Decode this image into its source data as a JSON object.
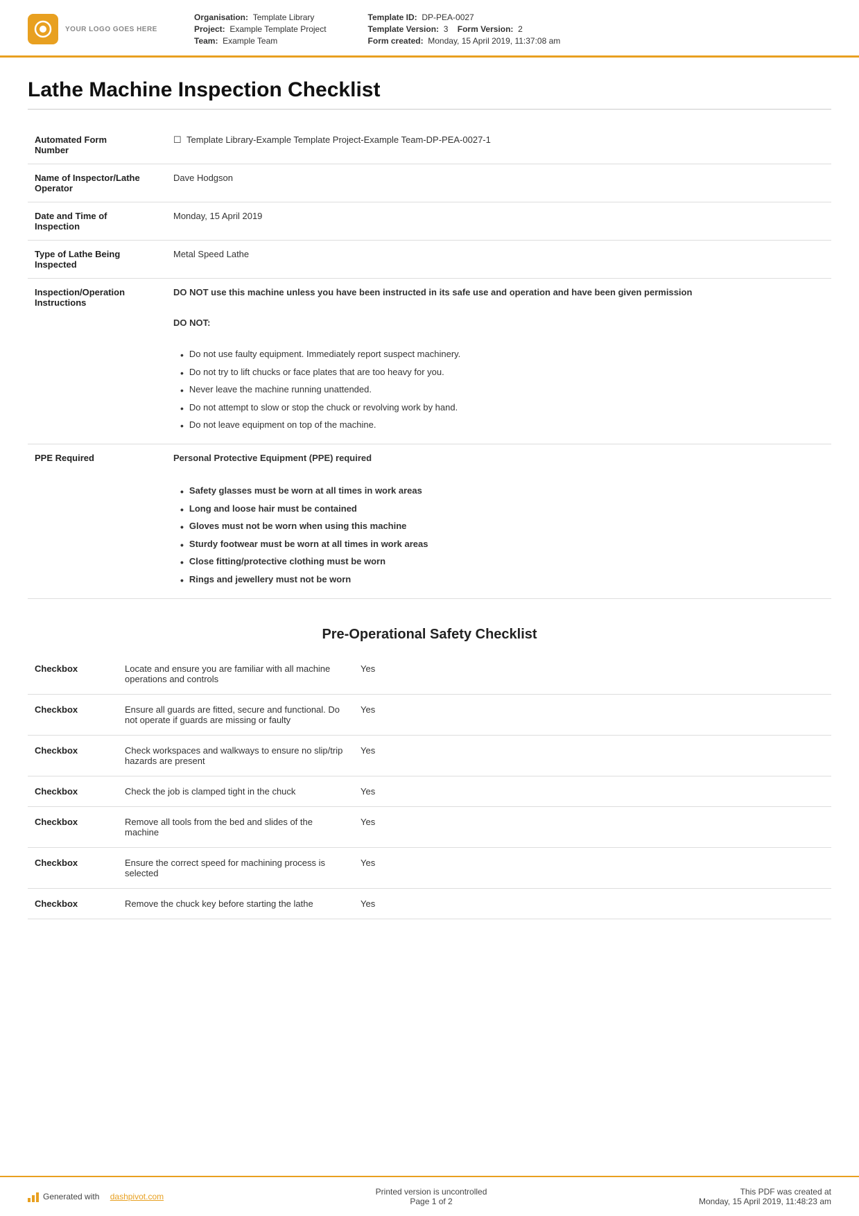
{
  "header": {
    "logo_text": "YOUR LOGO GOES HERE",
    "org_label": "Organisation:",
    "org_value": "Template Library",
    "project_label": "Project:",
    "project_value": "Example Template Project",
    "team_label": "Team:",
    "team_value": "Example Team",
    "template_id_label": "Template ID:",
    "template_id_value": "DP-PEA-0027",
    "template_version_label": "Template Version:",
    "template_version_value": "3",
    "form_version_label": "Form Version:",
    "form_version_value": "2",
    "form_created_label": "Form created:",
    "form_created_value": "Monday, 15 April 2019, 11:37:08 am"
  },
  "page_title": "Lathe Machine Inspection Checklist",
  "info_rows": [
    {
      "label": "Automated Form Number",
      "value": "Template Library-Example Template Project-Example Team-DP-PEA-0027-1",
      "has_icon": true
    },
    {
      "label": "Name of Inspector/Lathe Operator",
      "value": "Dave Hodgson"
    },
    {
      "label": "Date and Time of Inspection",
      "value": "Monday, 15 April 2019"
    },
    {
      "label": "Type of Lathe Being Inspected",
      "value": "Metal Speed Lathe"
    }
  ],
  "instructions": {
    "label": "Inspection/Operation Instructions",
    "bold_text": "DO NOT use this machine unless you have been instructed in its safe use and operation and have been given permission",
    "do_not_header": "DO NOT:",
    "do_not_items": [
      "Do not use faulty equipment. Immediately report suspect machinery.",
      "Do not try to lift chucks or face plates that are too heavy for you.",
      "Never leave the machine running unattended.",
      "Do not attempt to slow or stop the chuck or revolving work by hand.",
      "Do not leave equipment on top of the machine."
    ]
  },
  "ppe": {
    "label": "PPE Required",
    "header": "Personal Protective Equipment (PPE) required",
    "items": [
      "Safety glasses must be worn at all times in work areas",
      "Long and loose hair must be contained",
      "Gloves must not be worn when using this machine",
      "Sturdy footwear must be worn at all times in work areas",
      "Close fitting/protective clothing must be worn",
      "Rings and jewellery must not be worn"
    ]
  },
  "section_title": "Pre-Operational Safety Checklist",
  "checklist": {
    "col1_header": "Checkbox",
    "rows": [
      {
        "col1": "Checkbox",
        "col2": "Locate and ensure you are familiar with all machine operations and controls",
        "col3": "Yes"
      },
      {
        "col1": "Checkbox",
        "col2": "Ensure all guards are fitted, secure and functional. Do not operate if guards are missing or faulty",
        "col3": "Yes"
      },
      {
        "col1": "Checkbox",
        "col2": "Check workspaces and walkways to ensure no slip/trip hazards are present",
        "col3": "Yes"
      },
      {
        "col1": "Checkbox",
        "col2": "Check the job is clamped tight in the chuck",
        "col3": "Yes"
      },
      {
        "col1": "Checkbox",
        "col2": "Remove all tools from the bed and slides of the machine",
        "col3": "Yes"
      },
      {
        "col1": "Checkbox",
        "col2": "Ensure the correct speed for machining process is selected",
        "col3": "Yes"
      },
      {
        "col1": "Checkbox",
        "col2": "Remove the chuck key before starting the lathe",
        "col3": "Yes"
      }
    ]
  },
  "footer": {
    "generated_text": "Generated with",
    "link_text": "dashpivot.com",
    "uncontrolled_text": "Printed version is uncontrolled",
    "page_text": "Page 1 of 2",
    "pdf_created_label": "This PDF was created at",
    "pdf_created_value": "Monday, 15 April 2019, 11:48:23 am"
  }
}
